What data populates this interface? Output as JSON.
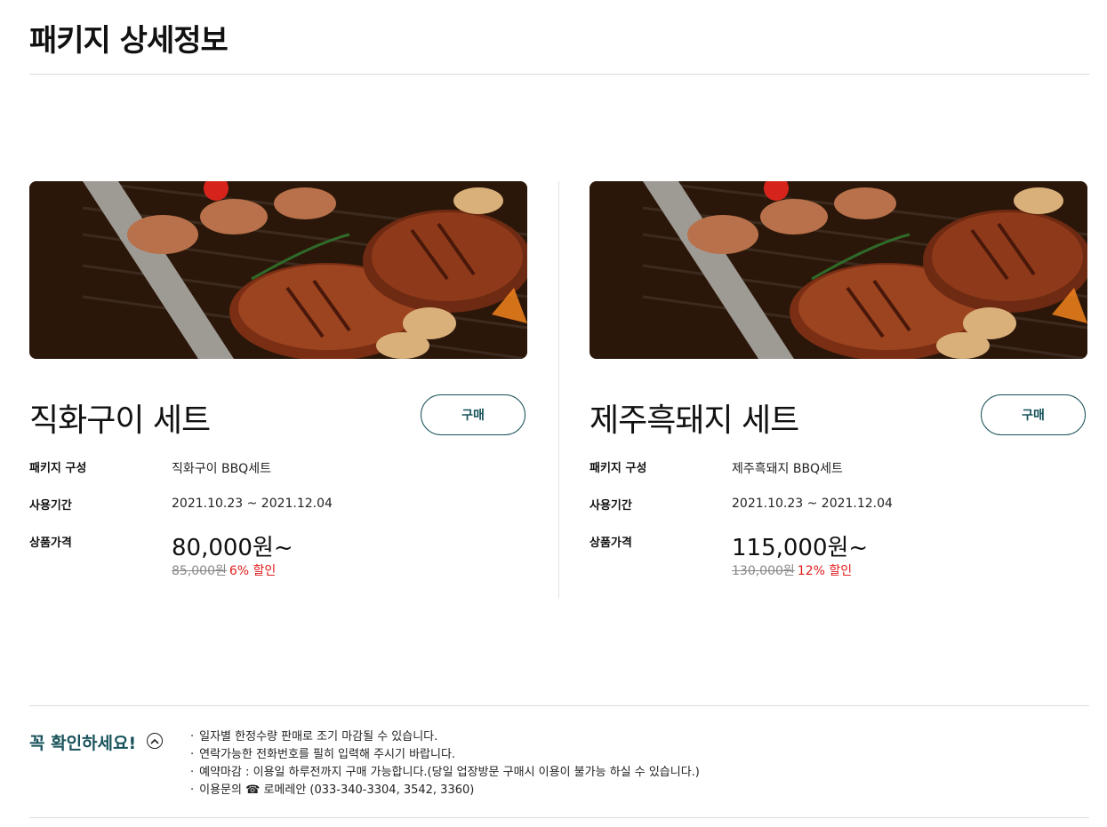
{
  "page": {
    "title": "패키지 상세정보"
  },
  "packages": [
    {
      "name": "직화구이 세트",
      "buy_label": "구매",
      "composition_label": "패키지 구성",
      "composition": "직화구이 BBQ세트",
      "period_label": "사용기간",
      "period": "2021.10.23 ~ 2021.12.04",
      "price_label": "상품가격",
      "price": "80,000원~",
      "original_price": "85,000원",
      "discount": "6% 할인"
    },
    {
      "name": "제주흑돼지 세트",
      "buy_label": "구매",
      "composition_label": "패키지 구성",
      "composition": "제주흑돼지 BBQ세트",
      "period_label": "사용기간",
      "period": "2021.10.23 ~ 2021.12.04",
      "price_label": "상품가격",
      "price": "115,000원~",
      "original_price": "130,000원",
      "discount": "12% 할인"
    }
  ],
  "notice": {
    "title": "꼭 확인하세요!",
    "toggle_icon": "chevron-up-circle-icon",
    "items": [
      "일자별 한정수량 판매로 조기 마감될 수 있습니다.",
      "연락가능한 전화번호를 필히 입력해 주시기 바랍니다.",
      "예약마감 : 이용일 하루전까지 구매 가능합니다.(당일 업장방문 구매시  이용이 불가능 하실 수 있습니다.)",
      "이용문의 ☎ 로메레안 (033-340-3304, 3542, 3360)"
    ]
  },
  "colors": {
    "accent": "#17525a",
    "discount": "#e01b1b",
    "strike": "#888888",
    "divider": "#dcdcdc"
  }
}
